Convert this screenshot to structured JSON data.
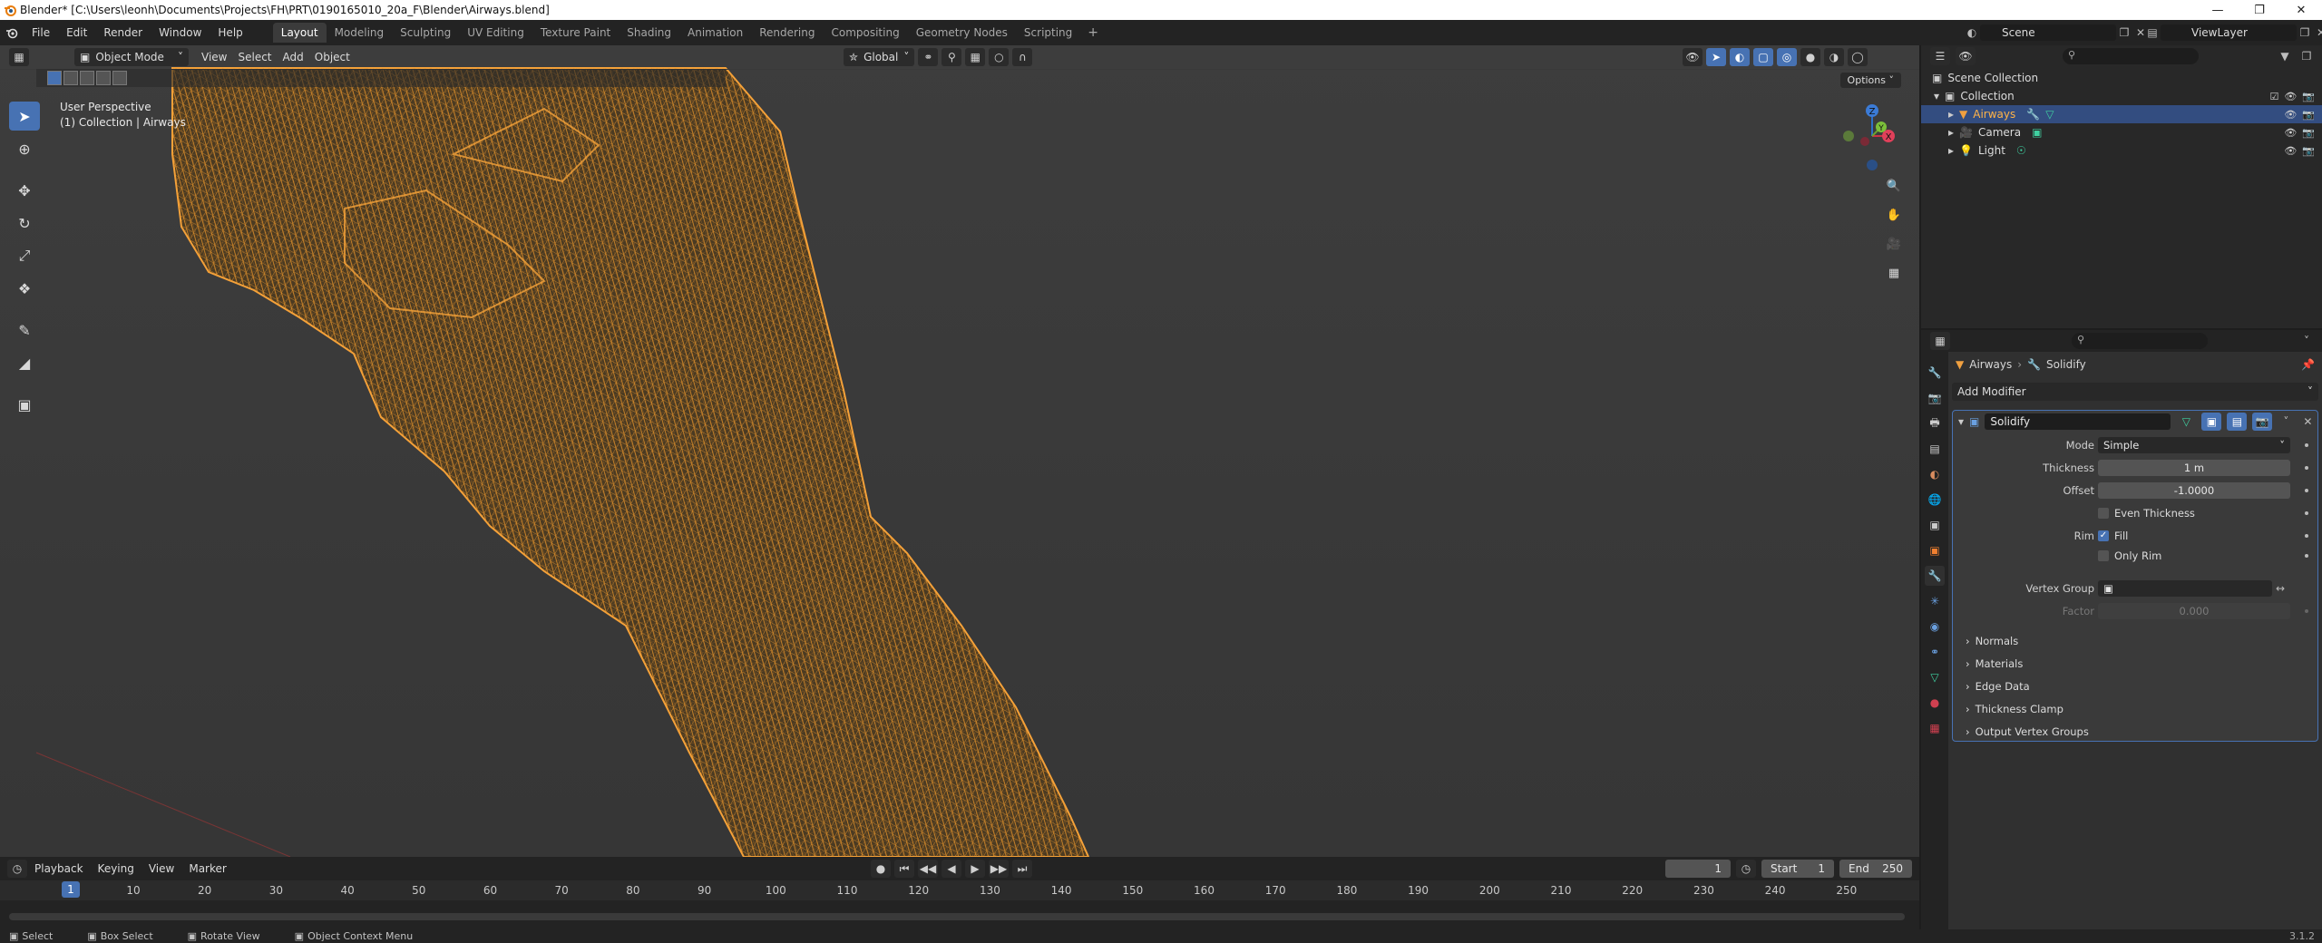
{
  "window": {
    "title": "Blender* [C:\\Users\\leonh\\Documents\\Projects\\FH\\PRT\\0190165010_20a_F\\Blender\\Airways.blend]"
  },
  "menu": [
    "File",
    "Edit",
    "Render",
    "Window",
    "Help"
  ],
  "workspaces": [
    "Layout",
    "Modeling",
    "Sculpting",
    "UV Editing",
    "Texture Paint",
    "Shading",
    "Animation",
    "Rendering",
    "Compositing",
    "Geometry Nodes",
    "Scripting"
  ],
  "active_workspace": "Layout",
  "scene": {
    "name": "Scene"
  },
  "view_layer": {
    "name": "ViewLayer"
  },
  "viewport": {
    "mode": "Object Mode",
    "menus": [
      "View",
      "Select",
      "Add",
      "Object"
    ],
    "orientation": "Global",
    "options_label": "Options",
    "info_line1": "User Perspective",
    "info_line2": "(1) Collection | Airways",
    "gizmo_axes": {
      "z": "Z",
      "y": "Y",
      "x": "X"
    },
    "wire_color": "#f09a2c"
  },
  "timeline": {
    "menus": [
      "Playback",
      "Keying",
      "View",
      "Marker"
    ],
    "current_frame": "1",
    "start_label": "Start",
    "start_value": "1",
    "end_label": "End",
    "end_value": "250",
    "ticks": [
      "10",
      "20",
      "30",
      "40",
      "50",
      "60",
      "70",
      "80",
      "90",
      "100",
      "110",
      "120",
      "130",
      "140",
      "150",
      "160",
      "170",
      "180",
      "190",
      "200",
      "210",
      "220",
      "230",
      "240",
      "250"
    ],
    "cursor_label": "1"
  },
  "statusbar": {
    "items": [
      "Select",
      "Box Select",
      "Rotate View",
      "Object Context Menu"
    ],
    "version": "3.1.2"
  },
  "outliner": {
    "scene_collection": "Scene Collection",
    "collection": "Collection",
    "objects": [
      {
        "name": "Airways",
        "selected": true
      },
      {
        "name": "Camera",
        "selected": false
      },
      {
        "name": "Light",
        "selected": false
      }
    ]
  },
  "properties": {
    "breadcrumb_object": "Airways",
    "breadcrumb_modifier": "Solidify",
    "add_modifier_label": "Add Modifier",
    "modifier": {
      "name": "Solidify",
      "mode_label": "Mode",
      "mode_value": "Simple",
      "thickness_label": "Thickness",
      "thickness_value": "1 m",
      "offset_label": "Offset",
      "offset_value": "-1.0000",
      "even_thickness_label": "Even Thickness",
      "rim_label": "Rim",
      "fill_label": "Fill",
      "only_rim_label": "Only Rim",
      "vertex_group_label": "Vertex Group",
      "factor_label": "Factor",
      "factor_value": "0.000",
      "subpanels": [
        "Normals",
        "Materials",
        "Edge Data",
        "Thickness Clamp",
        "Output Vertex Groups"
      ]
    }
  }
}
